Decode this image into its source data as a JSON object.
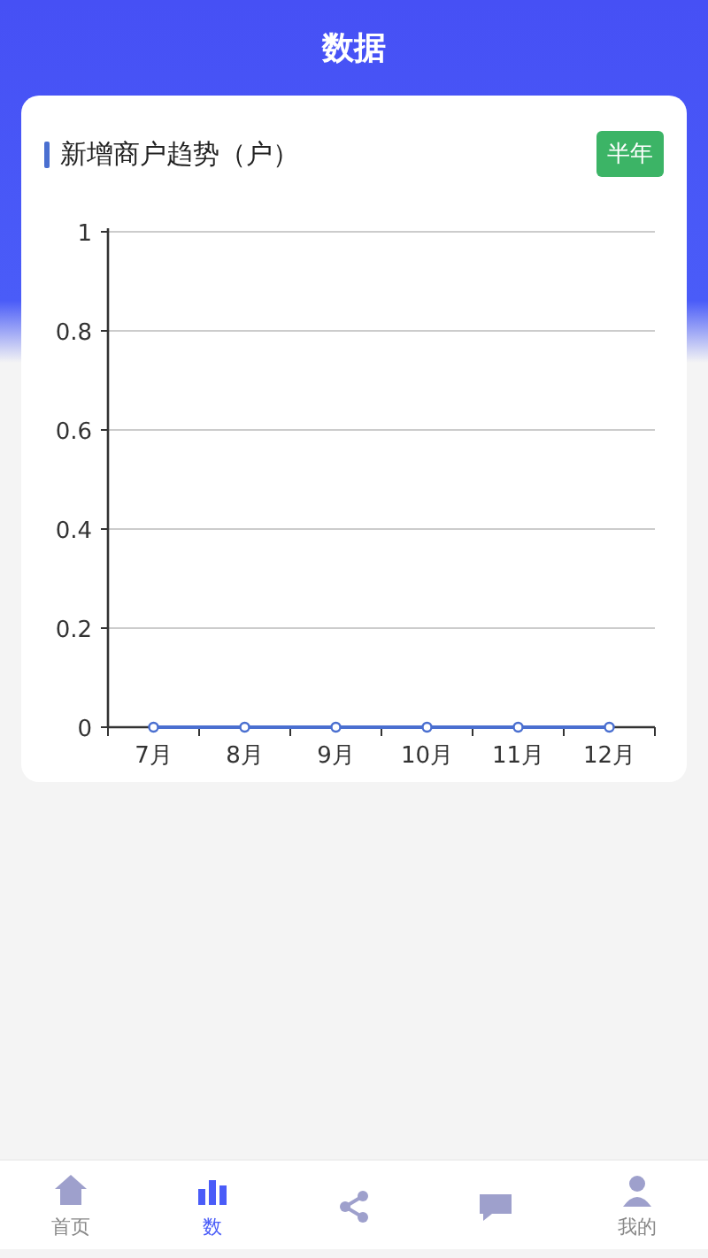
{
  "header": {
    "title": "数据"
  },
  "card": {
    "title": "新增商户趋势（户）",
    "period_button": "半年",
    "chart_data": {
      "type": "line",
      "categories": [
        "7月",
        "8月",
        "9月",
        "10月",
        "11月",
        "12月"
      ],
      "series": [
        {
          "color": "#4a6fd0",
          "marker": "circle",
          "values": [
            0,
            0,
            0,
            0,
            0,
            0
          ]
        }
      ],
      "grid": true,
      "ylim": [
        0,
        1
      ],
      "yticks": [
        0,
        0.2,
        0.4,
        0.6,
        0.8,
        1
      ]
    }
  },
  "tab_bar": [
    {
      "kind": "home",
      "label": "首页",
      "selected": false
    },
    {
      "kind": "chart",
      "label": "数",
      "selected": true
    },
    {
      "kind": "share",
      "selected": false
    },
    {
      "kind": "message",
      "selected": false
    },
    {
      "kind": "user",
      "label": "我的",
      "selected": false
    }
  ]
}
